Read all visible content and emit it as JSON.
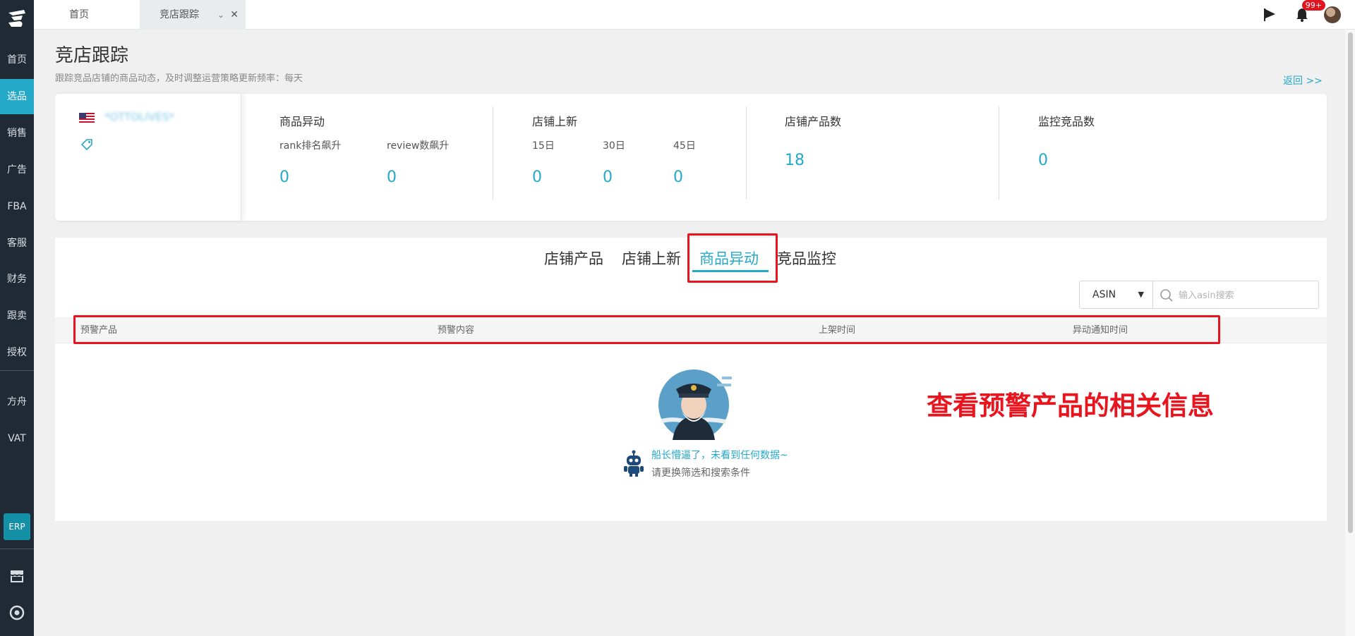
{
  "sidebar": {
    "items": [
      {
        "label": "首页"
      },
      {
        "label": "选品"
      },
      {
        "label": "销售"
      },
      {
        "label": "广告"
      },
      {
        "label": "FBA"
      },
      {
        "label": "客服"
      },
      {
        "label": "财务"
      },
      {
        "label": "跟卖"
      },
      {
        "label": "授权"
      },
      {
        "label": "方舟"
      },
      {
        "label": "VAT"
      }
    ],
    "erp_label": "ERP",
    "active_item": "选品"
  },
  "topbar": {
    "tabs": [
      {
        "label": "首页"
      },
      {
        "label": "竞店跟踪"
      }
    ],
    "notification_badge": "99+"
  },
  "page": {
    "title": "竞店跟踪",
    "subtitle": "跟踪竞品店铺的商品动态，及时调整运营策略更新频率：每天",
    "back_link": "返回 >>"
  },
  "store": {
    "name": "*OTTOLIVES*"
  },
  "stats": {
    "product_changes": {
      "title": "商品异动",
      "rank_label": "rank排名飙升",
      "rank_value": "0",
      "review_label": "review数飙升",
      "review_value": "0"
    },
    "new_listings": {
      "title": "店铺上新",
      "d15_label": "15日",
      "d15_value": "0",
      "d30_label": "30日",
      "d30_value": "0",
      "d45_label": "45日",
      "d45_value": "0"
    },
    "store_products": {
      "title": "店铺产品数",
      "value": "18"
    },
    "monitored": {
      "title": "监控竞品数",
      "value": "0"
    }
  },
  "main": {
    "tabs": [
      {
        "label": "店铺产品"
      },
      {
        "label": "店铺上新"
      },
      {
        "label": "商品异动"
      },
      {
        "label": "竞品监控"
      }
    ],
    "active_tab": "商品异动",
    "filter": {
      "select_value": "ASIN",
      "search_placeholder": "输入asin搜索"
    },
    "table_columns": [
      "预警产品",
      "预警内容",
      "上架时间",
      "异动通知时间"
    ],
    "empty_message": "船长懵逼了，未看到任何数据~",
    "empty_hint": "请更换筛选和搜索条件"
  },
  "annotation": {
    "text": "查看预警产品的相关信息",
    "color": "#e8141e"
  },
  "colors": {
    "accent": "#25a9c8",
    "sidebar_bg": "#1f2a34",
    "erp_bg": "#1390a5"
  }
}
